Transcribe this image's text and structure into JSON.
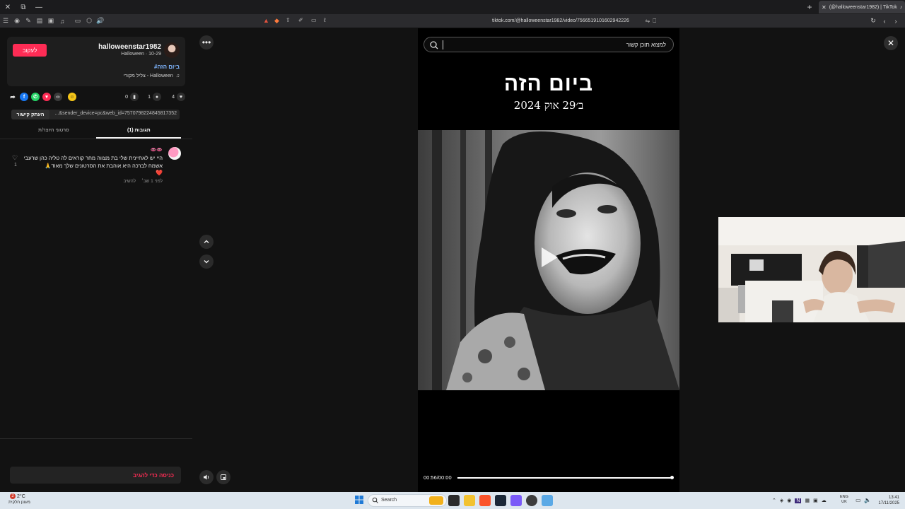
{
  "browser": {
    "tab_title": "(@halloweenstar1982) | TikTok",
    "url": "tiktok.com/@halloweenstar1982/video/7566519101602942226",
    "new_tab_symbol": "+"
  },
  "profile": {
    "username": "halloweenstar1982",
    "subline": "Halloween · 10-29",
    "follow_label": "לעקוב",
    "hashtag": "#ביום הזה",
    "music_icon_glyph": "♫",
    "music": "צליל מקורי - Halloween"
  },
  "stats": {
    "likes": "4",
    "comments": "1",
    "saves": "0"
  },
  "share": {
    "link_url": "...&sender_device=pc&web_id=7570798224845817352",
    "copy_label": "העתק קישור"
  },
  "tabs": {
    "comments_tab": "תגובות (1)",
    "creator_videos_tab": "סרטוני היוצר/ת"
  },
  "comment": {
    "emojis": "👄👄",
    "text": "היי יש לאחיינית שלי בת מצווה מחר קוראים לה טליה כהן שרעבי אשמח לברכה היא אוהבת את הסרטונים שלך מאוד🙏",
    "heart": "❤️",
    "likes": "1",
    "time": "לפני 1 שב׳",
    "reply_label": "להשיב"
  },
  "reply": {
    "login_prompt": "כניסה כדי להגיב"
  },
  "video": {
    "search_placeholder": "למצוא תוכן קשור",
    "caption_title": "ביום הזה",
    "caption_sub": "ב׳29 אוק 2024",
    "time": "00:56/00:00",
    "progress": 0.995
  },
  "taskbar": {
    "temperature": "2°C",
    "weather_text": "מעונן חלקית",
    "weather_badge": "2",
    "search_label": "Search",
    "lang_top": "ENG",
    "lang_bottom": "UK",
    "time": "13:41",
    "date": "17/11/2025"
  },
  "colors": {
    "accent": "#fe2c55",
    "link": "#7fb6ff",
    "background": "#121212"
  }
}
